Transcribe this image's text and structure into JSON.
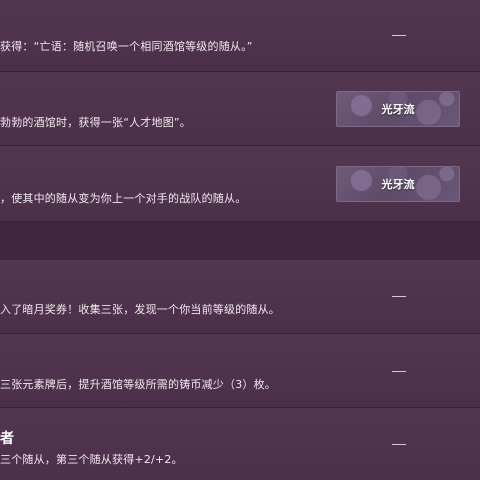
{
  "rows": [
    {
      "desc": "获得：“亡语：随机召唤一个相同酒馆等级的随从。”"
    },
    {
      "desc": "勃勃的酒馆时，获得一张“人才地图”。",
      "tag": "光牙流"
    },
    {
      "desc": "，使其中的随从变为你上一个对手的战队的随从。",
      "tag": "光牙流"
    },
    {
      "desc": "入了暗月奖券！收集三张，发现一个你当前等级的随从。"
    },
    {
      "desc": "三张元素牌后，提升酒馆等级所需的铸币减少（3）枚。"
    },
    {
      "title": "者",
      "desc": "三个随从，第三个随从获得+2/+2。"
    }
  ]
}
